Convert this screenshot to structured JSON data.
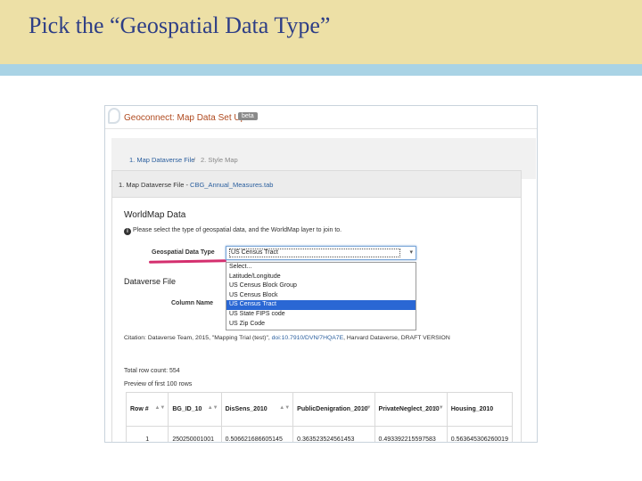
{
  "slide": {
    "title": "Pick the “Geospatial Data Type”"
  },
  "app": {
    "title": "Geoconnect: Map Data Set Up",
    "beta_badge": "beta"
  },
  "breadcrumb": {
    "step1": "1. Map Dataverse File",
    "separator": "/",
    "step2": "2. Style Map"
  },
  "panel": {
    "heading_prefix": "1. Map Dataverse File - ",
    "heading_file": "CBG_Annual_Measures.tab",
    "worldmap_title": "WorldMap Data",
    "info_text": "Please select the type of geospatial data, and the WorldMap layer to join to."
  },
  "form": {
    "geo_label": "Geospatial Data Type",
    "selected": "US Census Tract",
    "options": [
      "Select...",
      "Latitude/Longitude",
      "US Census Block Group",
      "US Census Block",
      "US Census Tract",
      "US State FIPS code",
      "US Zip Code"
    ],
    "highlighted_index": 4
  },
  "dataverse": {
    "title": "Dataverse File",
    "column_label": "Column Name"
  },
  "citation": {
    "prefix": "Citation: Dataverse Team, 2015, \"Mapping Trial (test)\", ",
    "doi": "doi:10.7910/DVN/7HQA7E",
    "suffix": ", Harvard Dataverse, DRAFT VERSION"
  },
  "stats": {
    "row_count": "Total row count: 554",
    "preview": "Preview of first 100 rows"
  },
  "table": {
    "headers": [
      "Row #",
      "BG_ID_10",
      "DisSens_2010",
      "PublicDenigration_2010",
      "PrivateNeglect_2010",
      "Housing_2010"
    ],
    "rows": [
      [
        "1",
        "250250001001",
        "0.506621686605145",
        "0.363523524561453",
        "0.493392215597583",
        "0.563645306260019"
      ]
    ]
  },
  "colors": {
    "title_band": "#ede0a6",
    "rule": "#a9d3e5",
    "title_text": "#2e3e86",
    "app_title": "#b04a1f",
    "link": "#2b5f9e",
    "highlight": "#2a67d4",
    "underline_mark": "#d42f6e"
  }
}
